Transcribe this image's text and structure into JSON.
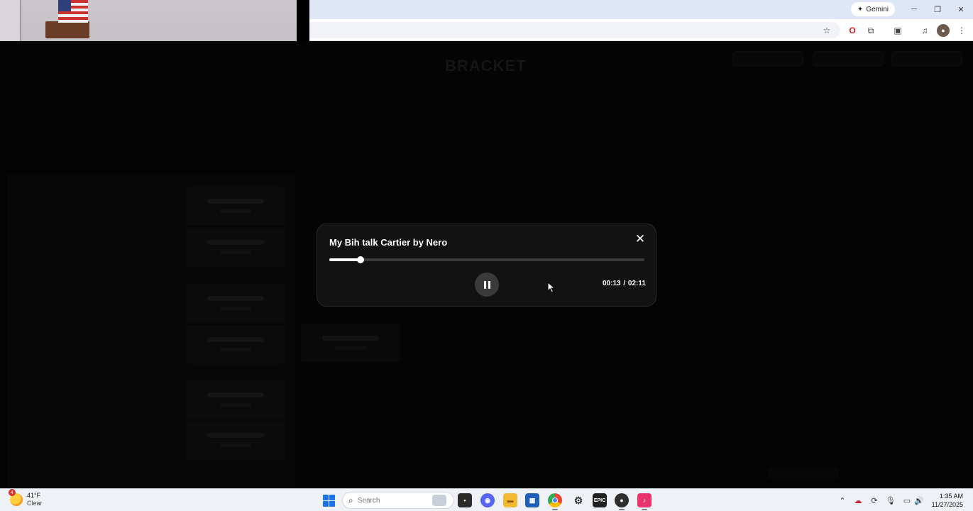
{
  "browser": {
    "gemini_label": "Gemini",
    "window_controls": [
      "minimize-icon",
      "restore-icon",
      "close-icon"
    ],
    "toolbar_icons": [
      "star-icon",
      "opera-icon",
      "extensions-icon",
      "tab-search-icon",
      "media-icon",
      "profile-icon",
      "menu-icon"
    ]
  },
  "page": {
    "title": "BRACKET"
  },
  "player": {
    "title": "My Bih talk Cartier by Nero",
    "current_time": "00:13",
    "separator": "/",
    "duration": "02:11",
    "progress": 0.099,
    "state": "playing",
    "close_icon": "close-icon",
    "pause_icon": "pause-icon"
  },
  "taskbar": {
    "weather": {
      "temperature": "41°F",
      "condition": "Clear",
      "badge": "4"
    },
    "search_placeholder": "Search",
    "apps": [
      "task-view-icon",
      "discord-icon",
      "file-explorer-icon",
      "store-icon",
      "chrome-icon",
      "steam-icon",
      "epic-games-icon",
      "obs-icon",
      "tiktok-icon"
    ],
    "tray_icons": [
      "chevron-up-icon",
      "onedrive-icon",
      "sync-icon",
      "microphone-icon",
      "display-icon",
      "volume-icon"
    ],
    "time": "1:35 AM",
    "date": "11/27/2025"
  }
}
